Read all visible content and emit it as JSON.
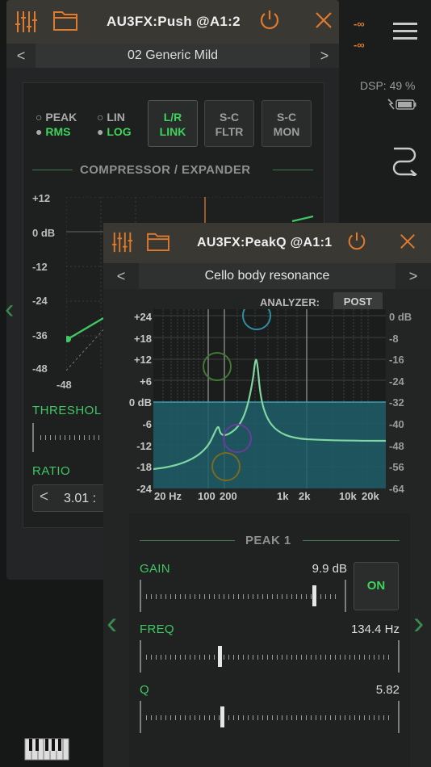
{
  "host": {
    "meter_top": "-∞",
    "meter_bottom": "-∞",
    "dsp_label": "DSP: 49 %"
  },
  "push_window": {
    "title": "AU3FX:Push @A1:2",
    "preset_name": "02 Generic Mild",
    "prev_arrow": "<",
    "next_arrow": ">",
    "radio_peak": "PEAK",
    "radio_rms": "RMS",
    "radio_lin": "LIN",
    "radio_log": "LOG",
    "btn_lr_1": "L/R",
    "btn_lr_2": "LINK",
    "btn_scf_1": "S-C",
    "btn_scf_2": "FLTR",
    "btn_scm_1": "S-C",
    "btn_scm_2": "MON",
    "section": "COMPRESSOR / EXPANDER",
    "y_labels": [
      "+12",
      "0 dB",
      "-12",
      "-24",
      "-36",
      "-48"
    ],
    "x_label": "-48",
    "threshold_label": "THRESHOL",
    "ratio_label": "RATIO",
    "ratio_arrow": "<",
    "ratio_value": "3.01 :"
  },
  "peakq_window": {
    "title": "AU3FX:PeakQ @A1:1",
    "preset_name": "Cello body resonance",
    "prev_arrow": "<",
    "next_arrow": ">",
    "analyzer_label": "ANALYZER:",
    "analyzer_mode": "POST",
    "left_axis": [
      "+24",
      "+18",
      "+12",
      "+6",
      "0 dB",
      "-6",
      "-12",
      "-18",
      "-24"
    ],
    "right_axis": [
      "0 dB",
      "-8",
      "-16",
      "-24",
      "-32",
      "-40",
      "-48",
      "-56",
      "-64"
    ],
    "x_axis": [
      "20 Hz",
      "100",
      "200",
      "1k",
      "2k",
      "10k",
      "20k"
    ],
    "section": "PEAK 1",
    "gain_label": "GAIN",
    "gain_value": "9.9 dB",
    "gain_level": 0.86,
    "on_label": "ON",
    "freq_label": "FREQ",
    "freq_value": "134.4 Hz",
    "freq_level": 0.29,
    "q_label": "Q",
    "q_value": "5.82",
    "q_level": 0.3
  },
  "colors": {
    "accent_orange": "#e07a2c",
    "accent_green": "#3ed35a",
    "curve": "#7fd6a2",
    "fill": "#1d5e6a"
  }
}
